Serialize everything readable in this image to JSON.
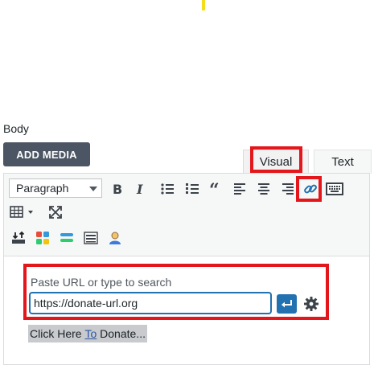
{
  "page": {
    "body_label": "Body",
    "add_media_label": "ADD MEDIA"
  },
  "tabs": [
    {
      "label": "Visual"
    },
    {
      "label": "Text"
    }
  ],
  "toolbar": {
    "format_value": "Paragraph",
    "row1_icons": [
      "bold-icon",
      "italic-icon",
      "bulleted-list-icon",
      "numbered-list-icon",
      "blockquote-icon",
      "align-left-icon",
      "align-center-icon",
      "align-right-icon",
      "insert-link-icon",
      "toolbar-toggle-icon"
    ],
    "row2_icons": [
      "table-icon",
      "fullscreen-icon"
    ],
    "row3_icons": [
      "insert-download-icon",
      "color-blocks-icon",
      "layers-icon",
      "columns-icon",
      "user-icon"
    ]
  },
  "link_dialog": {
    "hint": "Paste URL or type to search",
    "url_value": "https://donate-url.org",
    "apply_icon": "enter-arrow-icon",
    "settings_icon": "gear-icon"
  },
  "content": {
    "pre": "Click Here ",
    "underlined": "To",
    "post": " Donate..."
  },
  "colors": {
    "highlight_red": "#e3161b",
    "accent_blue": "#2271b1",
    "button_dark": "#4b5563"
  }
}
